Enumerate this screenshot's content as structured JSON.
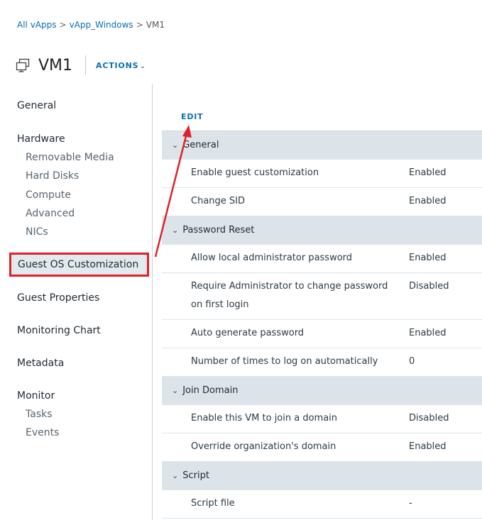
{
  "breadcrumb": {
    "item1": "All vApps",
    "item2": "vApp_Windows",
    "current": "VM1",
    "sep": ">"
  },
  "header": {
    "title": "VM1",
    "actions_label": "ACTIONS",
    "actions_caret": "⌄",
    "icon": "vm-icon"
  },
  "sidebar": {
    "general": "General",
    "hardware": "Hardware",
    "hardware_items": [
      "Removable Media",
      "Hard Disks",
      "Compute",
      "Advanced",
      "NICs"
    ],
    "guest_os": "Guest OS Customization",
    "guest_properties": "Guest Properties",
    "monitoring_chart": "Monitoring Chart",
    "metadata": "Metadata",
    "monitor": "Monitor",
    "monitor_items": [
      "Tasks",
      "Events"
    ]
  },
  "main": {
    "edit_label": "EDIT",
    "sections": [
      {
        "title": "General",
        "rows": [
          {
            "label": "Enable guest customization",
            "value": "Enabled"
          },
          {
            "label": "Change SID",
            "value": "Enabled"
          }
        ]
      },
      {
        "title": "Password Reset",
        "rows": [
          {
            "label": "Allow local administrator password",
            "value": "Enabled"
          },
          {
            "label": "Require Administrator to change password on first login",
            "value": "Disabled"
          },
          {
            "label": "Auto generate password",
            "value": "Enabled"
          },
          {
            "label": "Number of times to log on automatically",
            "value": "0"
          }
        ]
      },
      {
        "title": "Join Domain",
        "rows": [
          {
            "label": "Enable this VM to join a domain",
            "value": "Disabled"
          },
          {
            "label": "Override organization's domain",
            "value": "Enabled"
          }
        ]
      },
      {
        "title": "Script",
        "rows": [
          {
            "label": "Script file",
            "value": "-"
          }
        ]
      }
    ]
  },
  "colors": {
    "link": "#0a6fb3",
    "highlight_border": "#e0202a",
    "section_bg": "#dde4e9",
    "active_bg": "#e3eaee"
  }
}
